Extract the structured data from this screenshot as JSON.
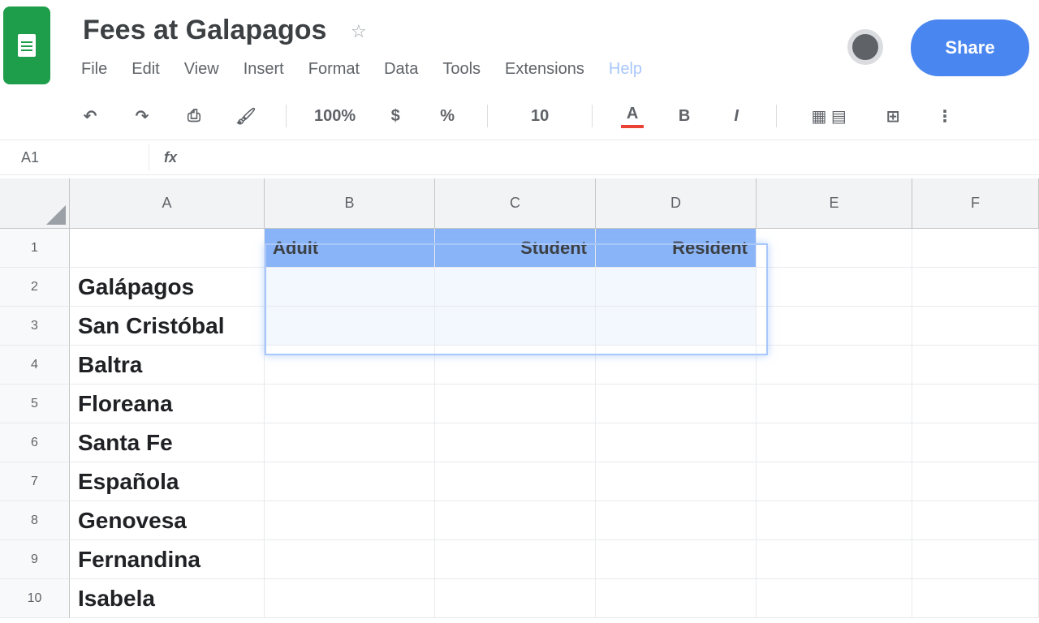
{
  "header": {
    "title": "Fees at Galapagos",
    "menu": [
      "File",
      "Edit",
      "View",
      "Insert",
      "Format",
      "Data",
      "Tools",
      "Extensions",
      "Help"
    ],
    "share_label": "Share"
  },
  "toolbar": {
    "zoom": "100%",
    "font_size": "10",
    "bold": "B",
    "italic": "I",
    "text_color_label": "A",
    "text_color": "#e94235"
  },
  "formula_bar": {
    "name_box": "A1",
    "fx": "fx",
    "value": ""
  },
  "grid": {
    "columns": [
      "A",
      "B",
      "C",
      "D",
      "E",
      "F"
    ],
    "row_numbers": [
      "1",
      "2",
      "3",
      "4",
      "5",
      "6",
      "7",
      "8",
      "9",
      "10"
    ],
    "table_headers": [
      "Adult",
      "Student",
      "Resident"
    ],
    "names": [
      "",
      "Galápagos",
      "San Cristóbal",
      "Baltra",
      "Floreana",
      "Santa Fe",
      "Española",
      "Genovesa",
      "Fernandina",
      "Isabela"
    ],
    "values": [
      "",
      "",
      "",
      "",
      "",
      "",
      "",
      "",
      "",
      ""
    ],
    "extra": [
      [
        "",
        "",
        "",
        "",
        ""
      ],
      [
        "",
        "",
        "",
        "",
        ""
      ],
      [
        "",
        "",
        "",
        "",
        ""
      ]
    ]
  },
  "colors": {
    "sheets_green": "#1e9e4a",
    "share_blue": "#4a86f0",
    "header_fill": "#8ab4f8",
    "selection_border": "#a8c7fa"
  }
}
